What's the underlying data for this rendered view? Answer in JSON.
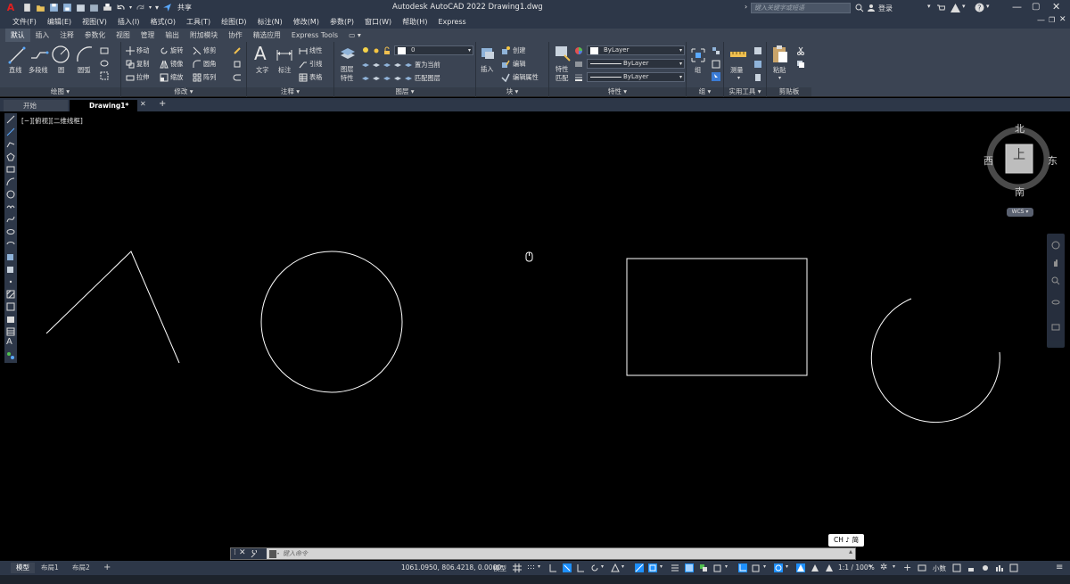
{
  "app": {
    "logo": "A",
    "window_title": "Autodesk AutoCAD 2022    Drawing1.dwg",
    "share_label": "共享",
    "search_placeholder": "键入关键字或短语",
    "login_label": "登录"
  },
  "menu": [
    "文件(F)",
    "编辑(E)",
    "视图(V)",
    "插入(I)",
    "格式(O)",
    "工具(T)",
    "绘图(D)",
    "标注(N)",
    "修改(M)",
    "参数(P)",
    "窗口(W)",
    "帮助(H)",
    "Express"
  ],
  "ribbon_tabs": [
    "默认",
    "插入",
    "注释",
    "参数化",
    "视图",
    "管理",
    "输出",
    "附加模块",
    "协作",
    "精选应用",
    "Express Tools"
  ],
  "ribbon": {
    "draw": {
      "title": "绘图",
      "line": "直线",
      "polyline": "多段线",
      "circle": "圆",
      "arc": "圆弧"
    },
    "modify": {
      "title": "修改",
      "move": "移动",
      "rotate": "旋转",
      "trim": "修剪",
      "copy": "复制",
      "mirror": "镜像",
      "fillet": "圆角",
      "stretch": "拉伸",
      "scale": "缩放",
      "array": "阵列"
    },
    "annotation": {
      "title": "注释",
      "text": "文字",
      "dimension": "标注",
      "linear": "线性",
      "leader": "引线",
      "table": "表格"
    },
    "layers": {
      "title": "图层",
      "properties_line1": "图层",
      "properties_line2": "特性",
      "current_layer": "0",
      "make_current": "置为当前",
      "match_layer": "匹配图层"
    },
    "block": {
      "title": "块",
      "insert": "插入",
      "create": "创建",
      "edit": "编辑",
      "edit_attributes": "编辑属性"
    },
    "properties": {
      "title": "特性",
      "match_line1": "特性",
      "match_line2": "匹配",
      "color": "ByLayer",
      "linetype": "ByLayer",
      "lineweight": "ByLayer"
    },
    "groups": {
      "title": "组",
      "group": "组"
    },
    "utilities": {
      "title": "实用工具",
      "measure": "测量"
    },
    "clipboard": {
      "title": "剪贴板",
      "paste": "粘贴"
    }
  },
  "file_tabs": {
    "start": "开始",
    "drawing": "Drawing1*"
  },
  "viewport_label": "[−][俯视][二维线框]",
  "viewcube": {
    "north": "北",
    "south": "南",
    "east": "东",
    "west": "西",
    "face": "上",
    "wcs": "WCS"
  },
  "command_line": {
    "placeholder": "键入命令"
  },
  "ime": "CH ♪ 简",
  "layout_tabs": [
    "模型",
    "布局1",
    "布局2"
  ],
  "status": {
    "coords": "1061.0950, 806.4218, 0.0000",
    "model": "模型",
    "scale": "1:1 / 100%",
    "decimal": "小数"
  },
  "colors": {
    "titlebar": "#2d3748",
    "ribbon": "#3b4453",
    "canvas": "#000000",
    "accent": "#1e90ff"
  }
}
